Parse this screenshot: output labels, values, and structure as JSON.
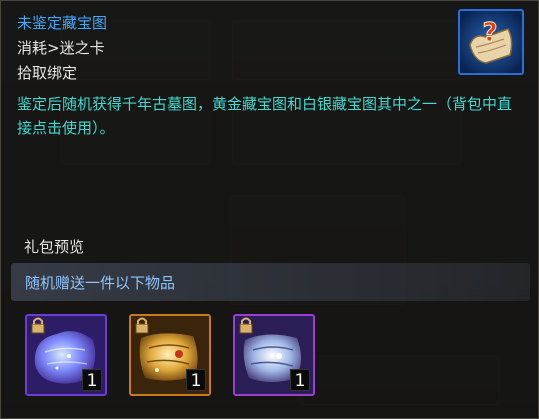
{
  "tooltip": {
    "title": "未鉴定藏宝图",
    "consume": "消耗>迷之卡",
    "bind": "拾取绑定",
    "description": "鉴定后随机获得千年古墓图，黄金藏宝图和白银藏宝图其中之一（背包中直接点击使用）。",
    "item_icon": "treasure-map-question-icon"
  },
  "package": {
    "title": "礼包预览",
    "subtitle": "随机赠送一件以下物品",
    "items": [
      {
        "icon": "blue-map-scroll-icon",
        "count": "1"
      },
      {
        "icon": "gold-map-scroll-icon",
        "count": "1"
      },
      {
        "icon": "silver-map-scroll-icon",
        "count": "1"
      }
    ]
  },
  "colors": {
    "title": "#3fa9ff",
    "description": "#3ddbd0",
    "subtitle": "#8fc4ff"
  }
}
